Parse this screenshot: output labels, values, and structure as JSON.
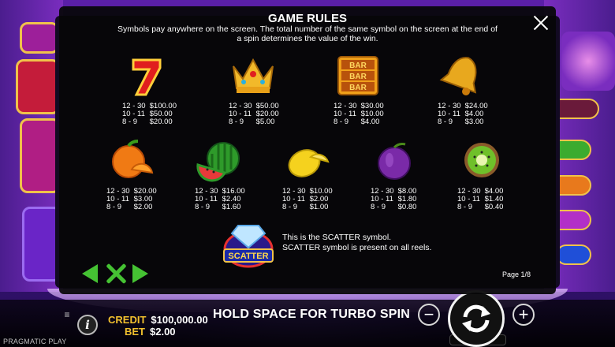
{
  "modal": {
    "title": "GAME RULES",
    "description": "Symbols pay anywhere on the screen. The total number of the same symbol on the screen at the end of a spin determines the value of the win.",
    "page_indicator": "Page 1/8"
  },
  "symbols": [
    {
      "name": "seven",
      "icon": "lucky-seven-icon",
      "pays": [
        [
          "12 - 30",
          "$100.00"
        ],
        [
          "10 - 11",
          "$50.00"
        ],
        [
          "8 - 9",
          "$20.00"
        ]
      ]
    },
    {
      "name": "crown",
      "icon": "crown-icon",
      "pays": [
        [
          "12 - 30",
          "$50.00"
        ],
        [
          "10 - 11",
          "$20.00"
        ],
        [
          "8 - 9",
          "$5.00"
        ]
      ]
    },
    {
      "name": "bar",
      "icon": "triple-bar-icon",
      "pays": [
        [
          "12 - 30",
          "$30.00"
        ],
        [
          "10 - 11",
          "$10.00"
        ],
        [
          "8 - 9",
          "$4.00"
        ]
      ]
    },
    {
      "name": "bell",
      "icon": "bell-icon",
      "pays": [
        [
          "12 - 30",
          "$24.00"
        ],
        [
          "10 - 11",
          "$4.00"
        ],
        [
          "8 - 9",
          "$3.00"
        ]
      ]
    },
    {
      "name": "orange",
      "icon": "orange-icon",
      "pays": [
        [
          "12 - 30",
          "$20.00"
        ],
        [
          "10 - 11",
          "$3.00"
        ],
        [
          "8 - 9",
          "$2.00"
        ]
      ]
    },
    {
      "name": "watermelon",
      "icon": "watermelon-icon",
      "pays": [
        [
          "12 - 30",
          "$16.00"
        ],
        [
          "10 - 11",
          "$2.40"
        ],
        [
          "8 - 9",
          "$1.60"
        ]
      ]
    },
    {
      "name": "lemon",
      "icon": "lemon-icon",
      "pays": [
        [
          "12 - 30",
          "$10.00"
        ],
        [
          "10 - 11",
          "$2.00"
        ],
        [
          "8 - 9",
          "$1.00"
        ]
      ]
    },
    {
      "name": "plum",
      "icon": "plum-icon",
      "pays": [
        [
          "12 - 30",
          "$8.00"
        ],
        [
          "10 - 11",
          "$1.80"
        ],
        [
          "8 - 9",
          "$0.80"
        ]
      ]
    },
    {
      "name": "kiwi",
      "icon": "kiwi-icon",
      "pays": [
        [
          "12 - 30",
          "$4.00"
        ],
        [
          "10 - 11",
          "$1.40"
        ],
        [
          "8 - 9",
          "$0.40"
        ]
      ]
    }
  ],
  "scatter": {
    "label": "SCATTER",
    "line1": "This is the SCATTER symbol.",
    "line2": "SCATTER symbol is present on all reels."
  },
  "bar_symbol_text": "BAR",
  "bottom_bar": {
    "credit_label": "CREDIT",
    "credit_value": "$100,000.00",
    "bet_label": "BET",
    "bet_value": "$2.00",
    "message": "HOLD SPACE FOR TURBO SPIN",
    "provider": "PRAGMATIC PLAY",
    "info_label": "i",
    "minus_label": "−",
    "plus_label": "+"
  },
  "colors": {
    "nav_green": "#45c233",
    "label_yellow": "#f2c12e"
  }
}
